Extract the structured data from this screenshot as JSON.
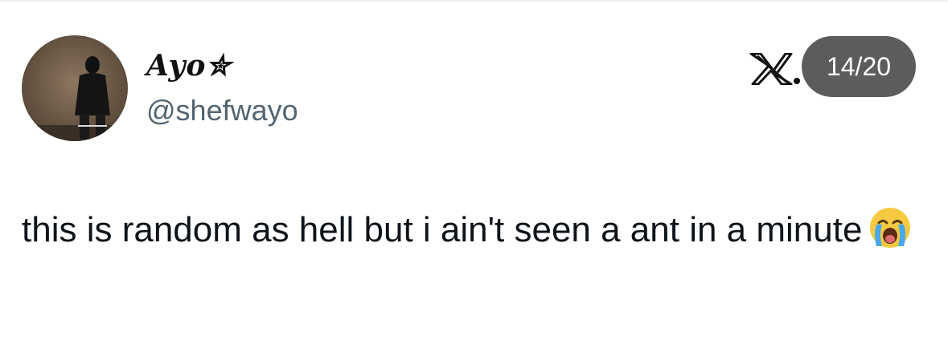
{
  "tweet": {
    "display_name": "Ayo✮",
    "handle": "@shefwayo",
    "text": "this is random as hell but i ain't seen a ant in a minute",
    "emoji": "loudly-crying-face-icon",
    "platform_logo": "x-logo-icon"
  },
  "counter": {
    "label": "14/20"
  },
  "colors": {
    "text": "#0f1419",
    "handle": "#536471",
    "counter_bg": "#5c5c5c",
    "background": "#ffffff"
  }
}
